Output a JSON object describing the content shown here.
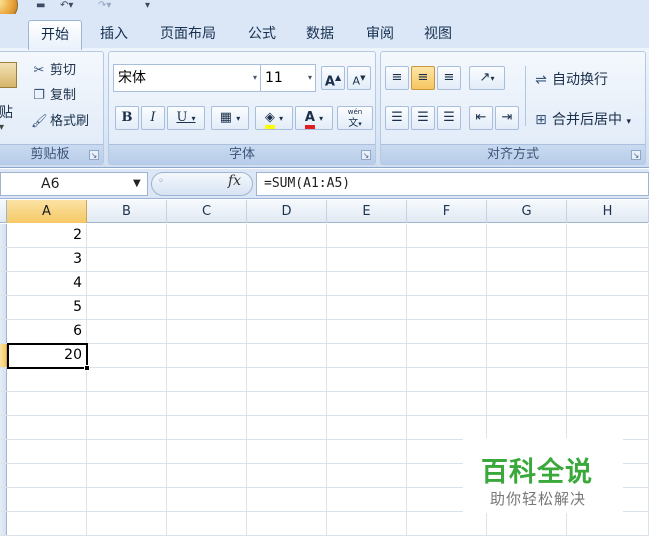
{
  "qat": {
    "undo_icon": "undo-icon",
    "redo_icon": "redo-icon"
  },
  "tabs": [
    {
      "label": "开始",
      "active": true
    },
    {
      "label": "插入",
      "active": false
    },
    {
      "label": "页面布局",
      "active": false
    },
    {
      "label": "公式",
      "active": false
    },
    {
      "label": "数据",
      "active": false
    },
    {
      "label": "审阅",
      "active": false
    },
    {
      "label": "视图",
      "active": false
    }
  ],
  "clipboard": {
    "paste_label": "贴",
    "cut_label": "剪切",
    "copy_label": "复制",
    "format_painter_label": "格式刷",
    "caption": "剪贴板"
  },
  "font": {
    "font_name": "宋体",
    "font_size": "11",
    "grow_label": "A",
    "shrink_label": "A",
    "bold": "B",
    "italic": "I",
    "underline": "U",
    "font_color_label": "A",
    "phonetic_label": "wén",
    "phonetic_char": "文",
    "caption": "字体",
    "highlight_color": "#ffff00",
    "font_color": "#e02020"
  },
  "alignment": {
    "wrap_text_label": "自动换行",
    "merge_center_label": "合并后居中",
    "caption": "对齐方式"
  },
  "formula_bar": {
    "name_box": "A6",
    "fx_label": "fx",
    "formula": "=SUM(A1:A5)"
  },
  "columns": [
    "A",
    "B",
    "C",
    "D",
    "E",
    "F",
    "G",
    "H"
  ],
  "selected_column": "A",
  "rows": [
    {
      "a": "2"
    },
    {
      "a": "3"
    },
    {
      "a": "4"
    },
    {
      "a": "5"
    },
    {
      "a": "6"
    },
    {
      "a": "20"
    },
    {
      "a": ""
    },
    {
      "a": ""
    },
    {
      "a": ""
    },
    {
      "a": ""
    },
    {
      "a": ""
    },
    {
      "a": ""
    },
    {
      "a": ""
    }
  ],
  "active_cell": "A6",
  "watermark": {
    "title": "百科全说",
    "subtitle": "助你轻松解决"
  }
}
